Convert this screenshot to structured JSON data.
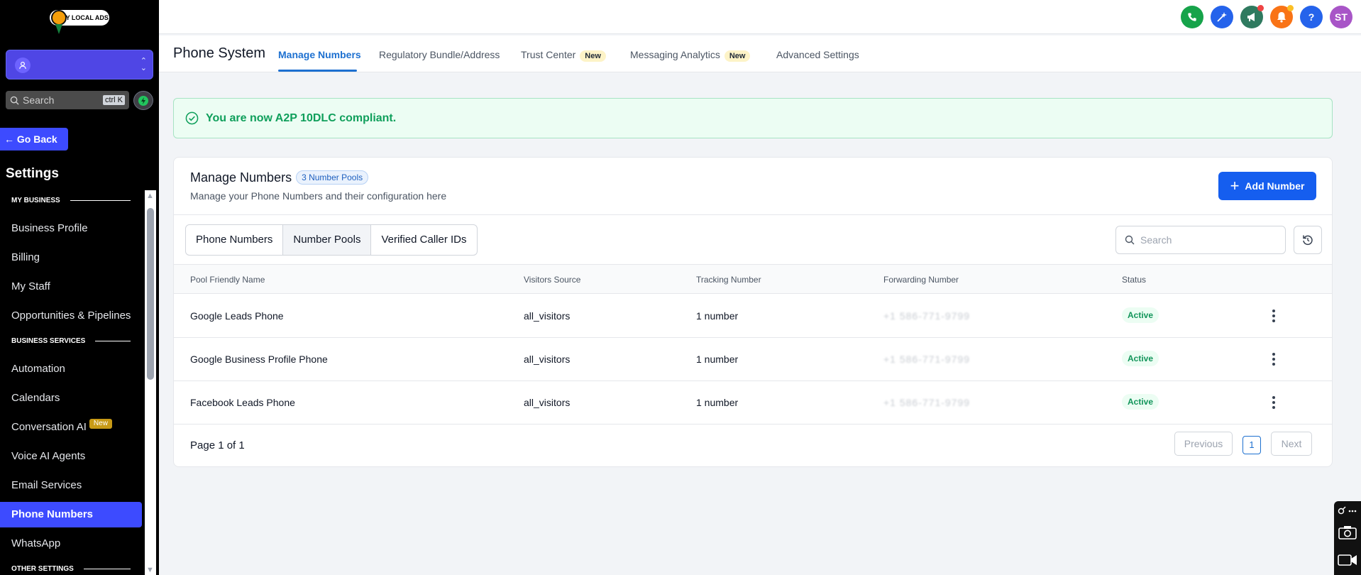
{
  "sidebar": {
    "logo_text": "MY LOCAL ADS",
    "search_placeholder": "Search",
    "search_shortcut": "ctrl K",
    "go_back": "← Go Back",
    "settings_title": "Settings",
    "sections": [
      {
        "label": "MY BUSINESS"
      },
      {
        "label": "BUSINESS SERVICES"
      },
      {
        "label": "OTHER SETTINGS"
      }
    ],
    "items": [
      {
        "label": "Business Profile"
      },
      {
        "label": "Billing"
      },
      {
        "label": "My Staff"
      },
      {
        "label": "Opportunities & Pipelines"
      },
      {
        "label": "Automation"
      },
      {
        "label": "Calendars"
      },
      {
        "label": "Conversation AI",
        "badge": "New"
      },
      {
        "label": "Voice AI Agents"
      },
      {
        "label": "Email Services"
      },
      {
        "label": "Phone Numbers",
        "active": true
      },
      {
        "label": "WhatsApp"
      }
    ]
  },
  "topbar": {
    "avatar_initials": "ST",
    "help_label": "?",
    "colors": {
      "phone": "#16a34a",
      "magic": "#2563eb",
      "megaphone": "#2f7a5f",
      "bell": "#f97316",
      "help": "#2563eb",
      "avatar": "#a855c7"
    }
  },
  "header": {
    "title": "Phone System",
    "tabs": [
      {
        "label": "Manage Numbers",
        "active": true
      },
      {
        "label": "Regulatory Bundle/Address"
      },
      {
        "label": "Trust Center",
        "badge": "New"
      },
      {
        "label": "Messaging Analytics",
        "badge": "New"
      },
      {
        "label": "Advanced Settings"
      }
    ]
  },
  "alert": {
    "text": "You are now A2P 10DLC compliant."
  },
  "card": {
    "title": "Manage Numbers",
    "pool_count": "3 Number Pools",
    "subtitle": "Manage your Phone Numbers and their configuration here",
    "add_button": "Add Number",
    "segments": [
      {
        "label": "Phone Numbers"
      },
      {
        "label": "Number Pools",
        "active": true
      },
      {
        "label": "Verified Caller IDs"
      }
    ],
    "search_placeholder": "Search",
    "columns": [
      "Pool Friendly Name",
      "Visitors Source",
      "Tracking Number",
      "Forwarding Number",
      "Status"
    ],
    "rows": [
      {
        "name": "Google Leads Phone",
        "source": "all_visitors",
        "tracking": "1 number",
        "forwarding": "+1 586-771-9799",
        "status": "Active"
      },
      {
        "name": "Google Business Profile Phone",
        "source": "all_visitors",
        "tracking": "1 number",
        "forwarding": "+1 586-771-9799",
        "status": "Active"
      },
      {
        "name": "Facebook Leads Phone",
        "source": "all_visitors",
        "tracking": "1 number",
        "forwarding": "+1 586-771-9799",
        "status": "Active"
      }
    ],
    "pagination": {
      "text": "Page 1 of 1",
      "previous": "Previous",
      "next": "Next",
      "current": "1"
    }
  }
}
